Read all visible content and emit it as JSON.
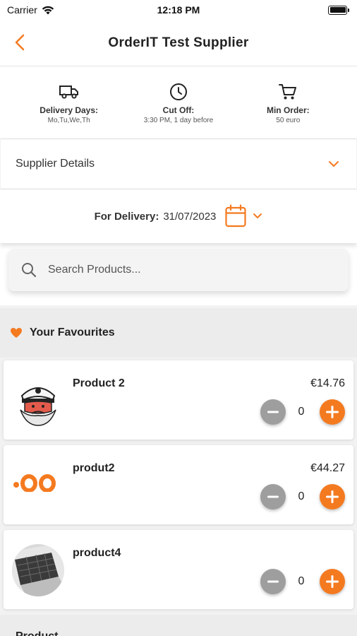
{
  "status_bar": {
    "carrier": "Carrier",
    "time": "12:18 PM"
  },
  "nav": {
    "title": "OrderIT Test Supplier"
  },
  "info": [
    {
      "label": "Delivery Days:",
      "value": "Mo,Tu,We,Th",
      "icon": "truck-icon"
    },
    {
      "label": "Cut Off:",
      "value": "3:30 PM, 1 day before",
      "icon": "clock-icon"
    },
    {
      "label": "Min Order:",
      "value": "50 euro",
      "icon": "cart-icon"
    }
  ],
  "supplier_details": {
    "label": "Supplier Details"
  },
  "delivery": {
    "label": "For Delivery:",
    "date": "31/07/2023"
  },
  "search": {
    "placeholder": "Search Products..."
  },
  "favourites": {
    "title": "Your Favourites",
    "items": [
      {
        "name": "Product 2",
        "price": "€14.76",
        "qty": "0",
        "image": "captain-illustration"
      },
      {
        "name": "produt2",
        "price": "€44.27",
        "qty": "0",
        "image": "orange-text-logo"
      },
      {
        "name": "product4",
        "price": "",
        "qty": "0",
        "image": "laptop-keyboard-photo"
      }
    ]
  },
  "next_section": {
    "title": "Product"
  },
  "colors": {
    "accent": "#f47a20",
    "minus": "#9e9e9e"
  }
}
